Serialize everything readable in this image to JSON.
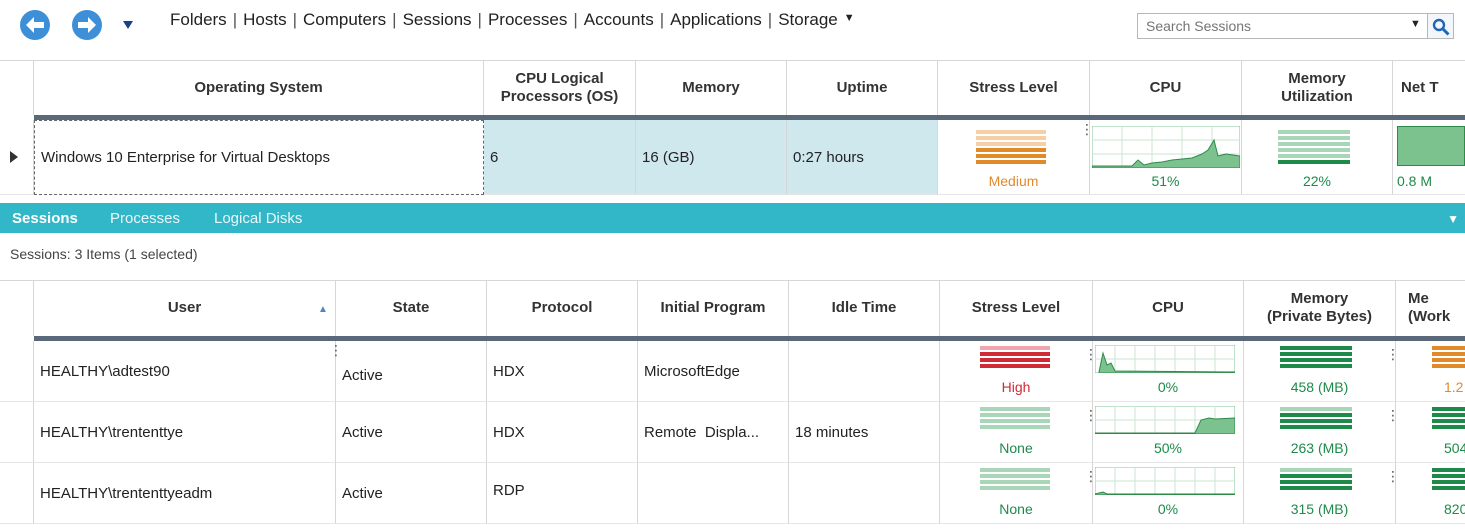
{
  "toolbar": {
    "menu": [
      "Folders",
      "Hosts",
      "Computers",
      "Sessions",
      "Processes",
      "Accounts",
      "Applications",
      "Storage"
    ],
    "search_placeholder": "Search Sessions",
    "icons": {
      "back": "arrow-left-icon",
      "forward": "arrow-right-icon",
      "history": "chevron-down-icon",
      "search": "magnifier-icon"
    }
  },
  "host_grid": {
    "headers": {
      "os": "Operating System",
      "cpu_lp": "CPU Logical Processors (OS)",
      "memory": "Memory",
      "uptime": "Uptime",
      "stress": "Stress Level",
      "cpu": "CPU",
      "mem_util": "Memory Utilization",
      "net": "Net T"
    },
    "row": {
      "os": "Windows 10 Enterprise for Virtual Desktops",
      "cpu_lp": "6",
      "memory": "16 (GB)",
      "uptime": "0:27 hours",
      "stress": "Medium",
      "cpu": "51%",
      "mem_util": "22%",
      "net": "0.8 M"
    }
  },
  "tabs": {
    "sessions": "Sessions",
    "processes": "Processes",
    "logical_disks": "Logical Disks"
  },
  "sessions_count": "Sessions: 3 Items (1 selected)",
  "session_grid": {
    "headers": {
      "user": "User",
      "state": "State",
      "protocol": "Protocol",
      "initial_program": "Initial Program",
      "idle_time": "Idle Time",
      "stress": "Stress Level",
      "cpu": "CPU",
      "mem_private_l1": "Memory",
      "mem_private_l2": "(Private Bytes)",
      "mem_work_l1": "Me",
      "mem_work_l2": "(Work"
    },
    "rows": [
      {
        "user": "HEALTHY\\adtest90",
        "state": "Active",
        "protocol": "HDX",
        "initial_program": "MicrosoftEdge",
        "idle_time": "",
        "stress": "High",
        "cpu": "0%",
        "mem_private": "458 (MB)",
        "mem_work": "1.2"
      },
      {
        "user": "HEALTHY\\trententtye",
        "state": "Active",
        "protocol": "HDX",
        "initial_program": "Remote  Displa...",
        "idle_time": "18 minutes",
        "stress": "None",
        "cpu": "50%",
        "mem_private": "263 (MB)",
        "mem_work": "504"
      },
      {
        "user": "HEALTHY\\trententtyeadm",
        "state": "Active",
        "protocol": "RDP",
        "initial_program": "",
        "idle_time": "",
        "stress": "None",
        "cpu": "0%",
        "mem_private": "315 (MB)",
        "mem_work": "820"
      }
    ]
  },
  "colors": {
    "accent": "#31b7c7",
    "nav": "#3d8fd8",
    "medium": "#e08a2a",
    "high": "#d02a36",
    "ok": "#1e8a4a",
    "none": "#a9d6b8"
  }
}
